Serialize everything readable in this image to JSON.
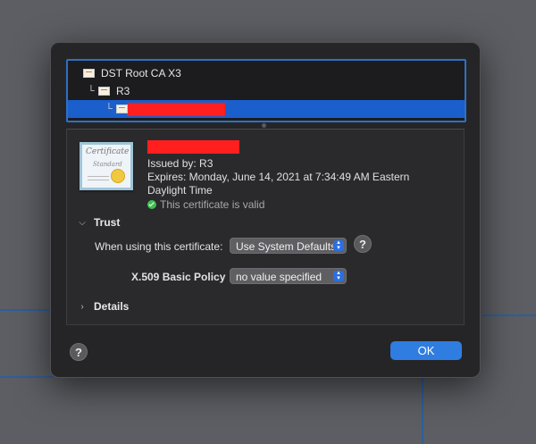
{
  "tree": {
    "items": [
      {
        "label": "DST Root CA X3"
      },
      {
        "label": "R3"
      },
      {
        "label": ""
      }
    ]
  },
  "certificate": {
    "issued_by": "Issued by: R3",
    "expires_line1": "Expires: Monday, June 14, 2021 at 7:34:49 AM Eastern",
    "expires_line2": "Daylight Time",
    "valid_text": "This certificate is valid",
    "icon_text_1": "Certificate",
    "icon_text_2": "Standard"
  },
  "trust": {
    "section_label": "Trust",
    "when_using_label": "When using this certificate:",
    "when_using_value": "Use System Defaults",
    "policy_label": "X.509 Basic Policy",
    "policy_value": "no value specified"
  },
  "details": {
    "section_label": "Details"
  },
  "buttons": {
    "help": "?",
    "ok": "OK"
  },
  "colors": {
    "accent": "#2f7de0",
    "selection": "#1a5fcc",
    "redaction": "#ff1f1f",
    "valid": "#3fbf4f"
  }
}
